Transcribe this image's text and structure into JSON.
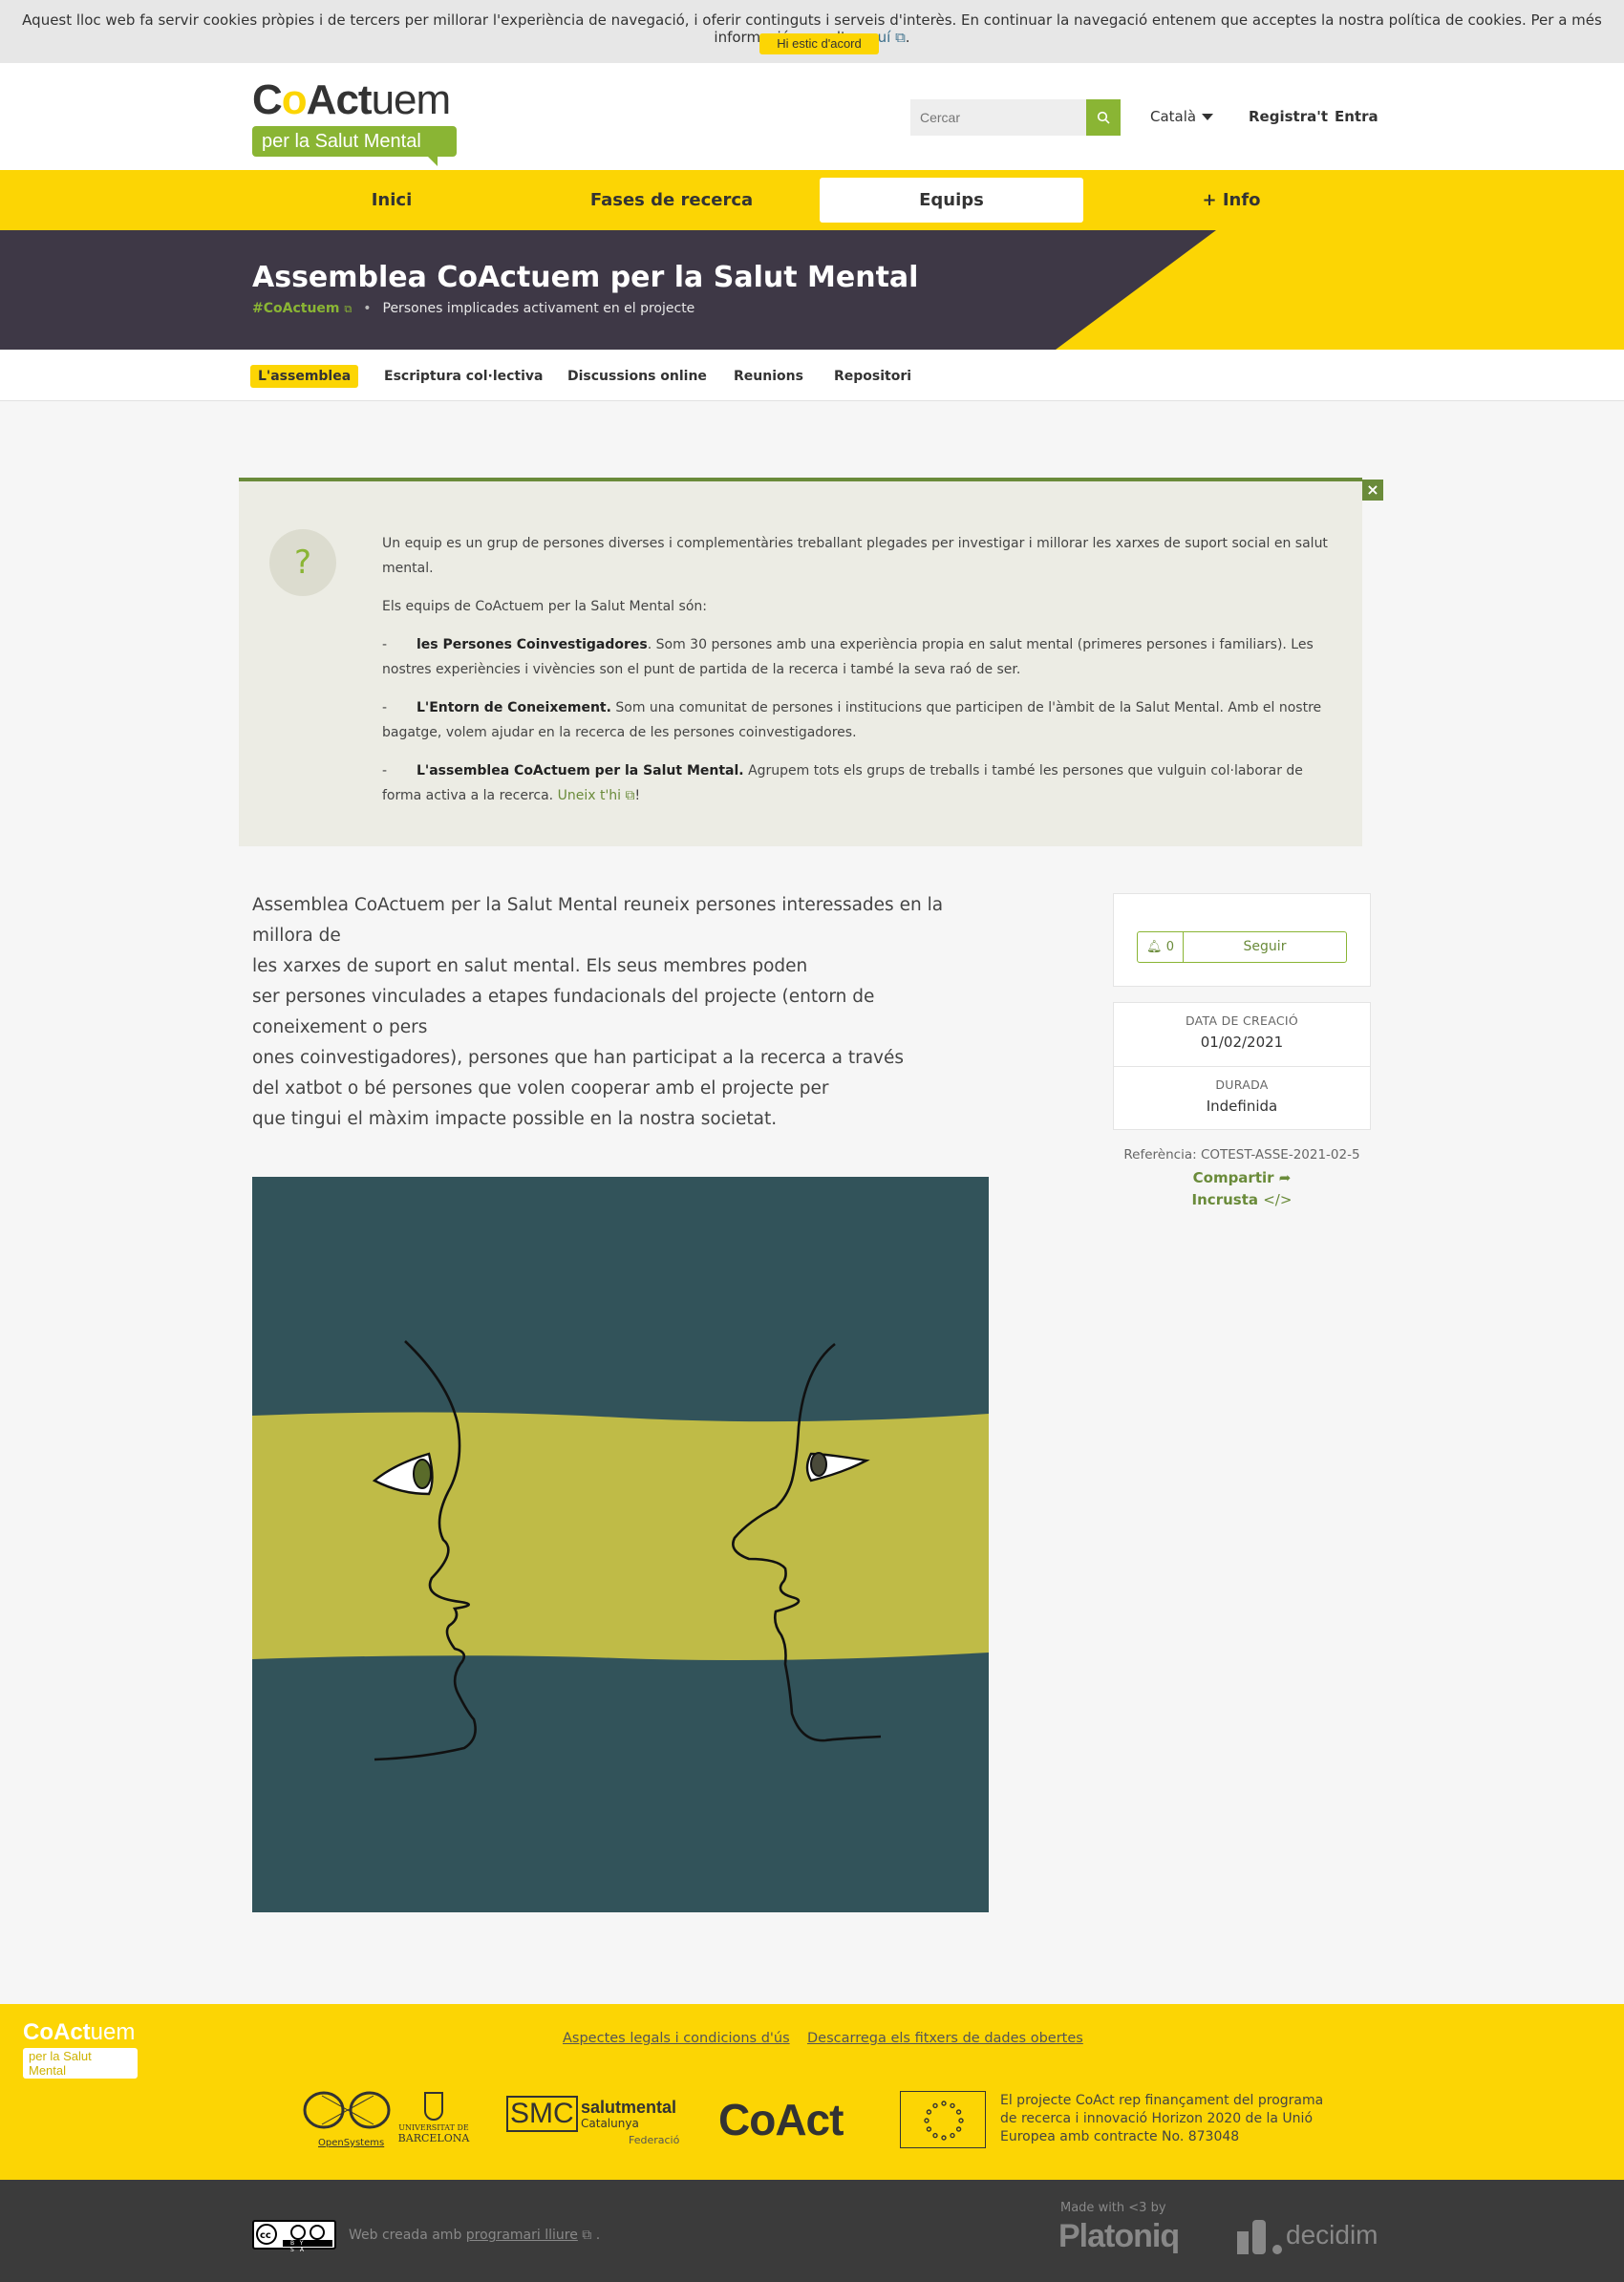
{
  "cookie": {
    "text": "Aquest lloc web fa servir cookies pròpies i de tercers per millorar l'experiència de navegació, i oferir continguts i serveis d'interès. En continuar la navegació entenem que acceptes la nostra política de cookies. Per a més informació consulta",
    "link": "aquí",
    "end": ".",
    "accept": "Hi estic d'acord"
  },
  "header": {
    "logo_co": "C",
    "logo_o": "o",
    "logo_act": "Act",
    "logo_uem": "uem",
    "logo_tag": "per la Salut Mental",
    "search_placeholder": "Cercar",
    "language": "Català",
    "register": "Registra't",
    "login": "Entra"
  },
  "mainnav": [
    "Inici",
    "Fases de recerca",
    "Equips",
    "+ Info"
  ],
  "hero": {
    "title": "Assemblea CoActuem per la Salut Mental",
    "hashtag": "#CoActuem",
    "subtitle": "Persones implicades activament en el projecte"
  },
  "subnav": [
    "L'assemblea",
    "Escriptura col·lectiva",
    "Discussions online",
    "Reunions",
    "Repositori"
  ],
  "info": {
    "close": "×",
    "question": "?",
    "p1": "Un equip es un grup de persones diverses i complementàries treballant plegades per investigar i millorar les xarxes de suport social en salut mental.",
    "p2": "Els equips de CoActuem per la Salut Mental són:",
    "dash": "-",
    "i1_bold": "les Persones Coinvestigadores",
    "i1_text": ". Som 30 persones amb una experiència propia en salut mental (primeres persones i familiars). Les nostres experiències i vivències son el punt de partida de la recerca i també la seva raó de ser.",
    "i2_bold": "L'Entorn de Coneixement.",
    "i2_text": " Som una comunitat de persones i institucions que participen de l'àmbit de la Salut Mental. Amb el nostre bagatge, volem ajudar en la recerca de les persones coinvestigadores.",
    "i3_bold": "L'assemblea CoActuem per la Salut Mental.",
    "i3_text": " Agrupem tots els grups de treballs i també les persones que vulguin col·laborar de forma activa a la recerca. ",
    "i3_link": "Uneix t'hi",
    "i3_end": "!"
  },
  "description": [
    "Assemblea CoActuem per la Salut Mental reuneix persones interessades en la millora de",
    "les xarxes de suport en salut mental. Els seus membres poden",
    "ser persones vinculades a etapes fundacionals del projecte (entorn de coneixement o pers",
    "ones coinvestigadores), persones que han participat a la recerca a través",
    "del xatbot o bé persones que volen cooperar amb el projecte per",
    "que tingui el màxim impacte possible en la nostra societat."
  ],
  "sidebar": {
    "follow_count": "0",
    "follow_label": "Seguir",
    "created_label": "DATA DE CREACIÓ",
    "created_value": "01/02/2021",
    "duration_label": "DURADA",
    "duration_value": "Indefinida",
    "reference": "Referència: COTEST-ASSE-2021-02-5",
    "share": "Compartir",
    "embed": "Incrusta"
  },
  "footer": {
    "logo_co": "CoAct",
    "logo_uem": "uem",
    "logo_tag": "per la Salut Mental",
    "legal": "Aspectes legals i condicions d'ús",
    "open_data": "Descarrega els fitxers de dades obertes",
    "os_label": "OpenSystems",
    "ub_label_1": "UNIVERSITAT DE",
    "ub_label_2": "BARCELONA",
    "smc": "SMC",
    "smc_name": "salutmental",
    "smc_region": "Catalunya",
    "smc_fed": "Federació",
    "coact": "CoAct",
    "eu_text": "El projecte CoAct rep finançament del programa de recerca i innovació Horizon 2020 de la Unió Europea amb contracte No. 873048"
  },
  "bottom": {
    "web_prefix": "Web creada amb",
    "web_link": "programari lliure",
    "web_end": ".",
    "made_with": "Made with <3 by",
    "platoniq": "Platoniq",
    "decidim": "decidim",
    "cc_label": "BY SA"
  },
  "colors": {
    "yellow": "#fcd504",
    "green": "#8ab534",
    "dark_green": "#6a8b3a",
    "hero_dark": "#3e3846",
    "art_teal": "#32535a",
    "art_olive": "#bfbb47"
  }
}
